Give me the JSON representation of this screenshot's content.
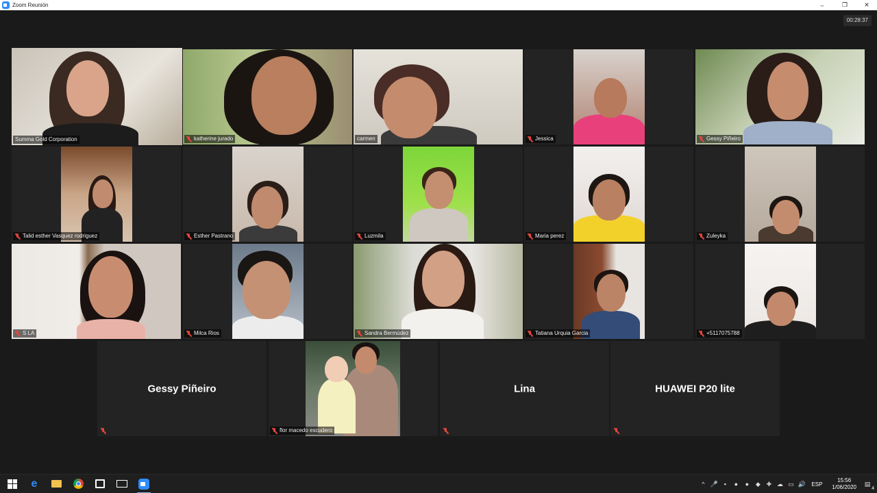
{
  "window": {
    "title": "Zoom Reunión",
    "minimize": "–",
    "restore": "❐",
    "close": "✕"
  },
  "meeting": {
    "timer": "00:28:37"
  },
  "participants": [
    {
      "name": "Summa Gold Corporation",
      "muted": false
    },
    {
      "name": "katherine jurado",
      "muted": true
    },
    {
      "name": "carmen",
      "muted": false
    },
    {
      "name": "Jessica",
      "muted": true
    },
    {
      "name": "Gessy Piñeiro",
      "muted": true
    },
    {
      "name": "Talid esther Vasquez rodriguez",
      "muted": true
    },
    {
      "name": "Esther Pastrano",
      "muted": true
    },
    {
      "name": "Luzmila",
      "muted": true
    },
    {
      "name": "Maria perez",
      "muted": true
    },
    {
      "name": "Zuleyka",
      "muted": true
    },
    {
      "name": "S LA",
      "muted": true
    },
    {
      "name": "Milca Rios",
      "muted": true
    },
    {
      "name": "Sandra Bermúdez",
      "muted": true
    },
    {
      "name": "Tatiana Urquia Garcia",
      "muted": true
    },
    {
      "name": "+5117075788",
      "muted": true
    },
    {
      "name": "Gessy Piñeiro",
      "muted": true,
      "video_off": true
    },
    {
      "name": "flor macedo escudero",
      "muted": true
    },
    {
      "name": "Lina",
      "muted": true,
      "video_off": true
    },
    {
      "name": "HUAWEI P20 lite",
      "muted": true,
      "video_off": true
    }
  ],
  "taskbar": {
    "apps": [
      "windows-start",
      "edge",
      "file-explorer",
      "chrome",
      "store",
      "mail",
      "zoom"
    ],
    "language": "ESP",
    "time": "15:56",
    "date": "1/06/2020",
    "notifications": "4"
  },
  "colors": {
    "active_speaker": "#d9d96a",
    "muted_icon": "#e5463c",
    "zoom_blue": "#2d8cff"
  }
}
